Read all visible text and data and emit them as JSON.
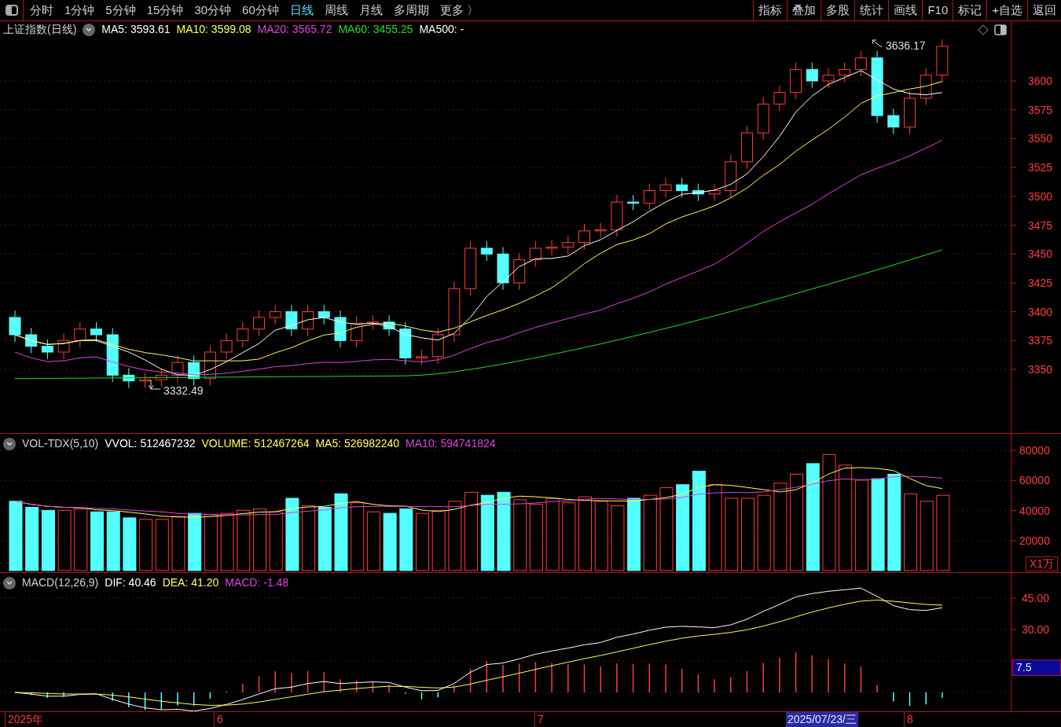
{
  "toolbar": {
    "periods": [
      {
        "label": "分时",
        "selected": false
      },
      {
        "label": "1分钟",
        "selected": false
      },
      {
        "label": "5分钟",
        "selected": false
      },
      {
        "label": "15分钟",
        "selected": false
      },
      {
        "label": "30分钟",
        "selected": false
      },
      {
        "label": "60分钟",
        "selected": false
      },
      {
        "label": "日线",
        "selected": true
      },
      {
        "label": "周线",
        "selected": false
      },
      {
        "label": "月线",
        "selected": false
      },
      {
        "label": "多周期",
        "selected": false
      },
      {
        "label": "更多 〉",
        "selected": false
      }
    ],
    "actions": [
      "指标",
      "叠加",
      "多股",
      "统计",
      "画线",
      "F10",
      "标记",
      "+自选",
      "返回"
    ]
  },
  "price_pane": {
    "title": "上证指数(日线)",
    "indicators": [
      {
        "label": "MA5: 3593.61",
        "color": "#ffffff"
      },
      {
        "label": "MA10: 3599.08",
        "color": "#ffff55"
      },
      {
        "label": "MA20: 3565.72",
        "color": "#e040e0"
      },
      {
        "label": "MA60: 3455.25",
        "color": "#22dd22"
      },
      {
        "label": "MA500: -",
        "color": "#ffffff"
      }
    ],
    "y_ticks": [
      "3600",
      "3575",
      "3550",
      "3525",
      "3500",
      "3475",
      "3450",
      "3425",
      "3400",
      "3375",
      "3350"
    ],
    "high_label": "3636.17",
    "low_label": "3332.49"
  },
  "volume_pane": {
    "title": "VOL-TDX(5,10)",
    "indicators": [
      {
        "label": "VVOL: 512467232",
        "color": "#ffffff"
      },
      {
        "label": "VOLUME: 512467264",
        "color": "#ffff55"
      },
      {
        "label": "MA5: 526982240",
        "color": "#ffff55"
      },
      {
        "label": "MA10: 594741824",
        "color": "#e040e0"
      }
    ],
    "y_ticks": [
      "80000",
      "60000",
      "40000",
      "20000"
    ],
    "unit": "X1万"
  },
  "macd_pane": {
    "title": "MACD(12,26,9)",
    "indicators": [
      {
        "label": "DIF: 40.46",
        "color": "#ffffff"
      },
      {
        "label": "DEA: 41.20",
        "color": "#ffff55"
      },
      {
        "label": "MACD: -1.48",
        "color": "#e040e0"
      }
    ],
    "y_ticks": [
      "45.00",
      "30.00"
    ],
    "cursor_value": "7.5"
  },
  "date_axis": {
    "labels": [
      "2025年",
      "6",
      "7",
      "8"
    ],
    "cursor_date": "2025/07/23/三"
  }
}
